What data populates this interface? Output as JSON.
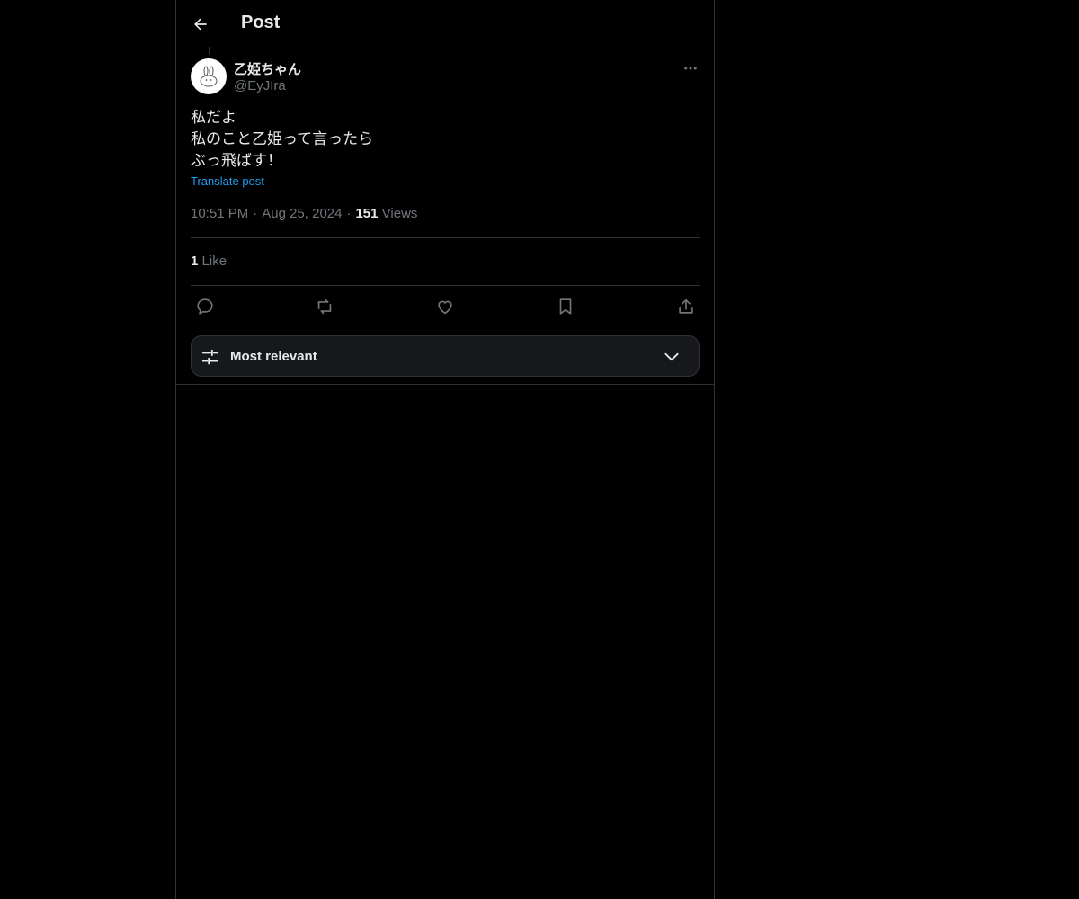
{
  "header": {
    "back_icon": "arrow-left-icon",
    "title": "Post"
  },
  "post": {
    "author": {
      "display_name": "乙姫ちゃん",
      "handle": "@EyJIra",
      "avatar_icon": "rabbit-doodle-icon"
    },
    "more_icon": "more-horizontal-icon",
    "text_lines": [
      "私だよ",
      "私のこと乙姫って言ったら",
      "ぶっ飛ばす！"
    ],
    "translate_label": "Translate post",
    "time": "10:51 PM",
    "separator": "·",
    "date": "Aug 25, 2024",
    "views_count": "151",
    "views_label": "Views",
    "likes_count": "1",
    "likes_label": "Like",
    "actions": [
      "reply-icon",
      "repost-icon",
      "like-icon",
      "bookmark-icon",
      "share-icon"
    ]
  },
  "replies_sort": {
    "label": "Most relevant",
    "icon": "sliders-icon",
    "chevron_icon": "chevron-down-icon"
  },
  "colors": {
    "background": "#000000",
    "text_primary": "#e7e9ea",
    "text_secondary": "#71767b",
    "accent": "#1d9bf0",
    "border": "#2f3336"
  }
}
